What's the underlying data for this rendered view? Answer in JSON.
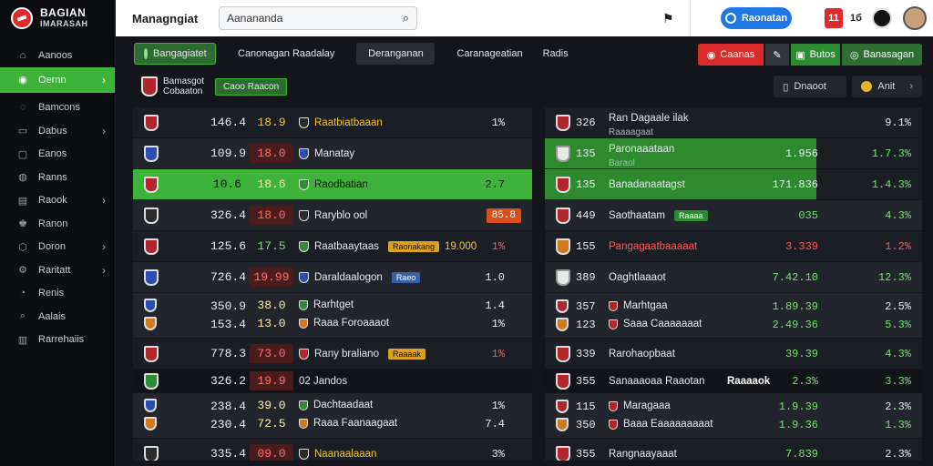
{
  "brand": {
    "line1": "BAGIAN",
    "line2": "IMARASAH"
  },
  "sidebar": {
    "items": [
      {
        "label": "Aanoos",
        "icon": "home-icon",
        "chevron": false,
        "active": false
      },
      {
        "label": "Oernn",
        "icon": "globe-icon",
        "chevron": true,
        "active": true
      },
      {
        "label": "Bamcons",
        "icon": "chat-icon",
        "chevron": false,
        "active": false
      },
      {
        "label": "Dabus",
        "icon": "folder-icon",
        "chevron": true,
        "active": false
      },
      {
        "label": "Eanos",
        "icon": "calendar-icon",
        "chevron": false,
        "active": false
      },
      {
        "label": "Ranns",
        "icon": "people-icon",
        "chevron": false,
        "active": false
      },
      {
        "label": "Raook",
        "icon": "book-icon",
        "chevron": true,
        "active": false
      },
      {
        "label": "Ranon",
        "icon": "trophy-icon",
        "chevron": false,
        "active": false
      },
      {
        "label": "Doron",
        "icon": "shield-icon",
        "chevron": true,
        "active": false
      },
      {
        "label": "Raritatt",
        "icon": "gear-icon",
        "chevron": true,
        "active": false
      },
      {
        "label": "Renis",
        "icon": "user-icon",
        "chevron": false,
        "active": false
      },
      {
        "label": "Aalais",
        "icon": "search-icon",
        "chevron": false,
        "active": false
      },
      {
        "label": "Rarrehaiis",
        "icon": "chart-icon",
        "chevron": false,
        "active": false
      }
    ]
  },
  "header": {
    "title": "Managngiat",
    "search_value": "Aanananda",
    "cta_label": "Raonatan",
    "badge": "11",
    "count": "1б"
  },
  "toolbar": {
    "tabs": [
      "Bangagiatet",
      "Canonagan Raadalay",
      "Deranganan",
      "Caranageatian",
      "Radis"
    ],
    "btn_red": "Caanas",
    "btn_green": "Butos",
    "btn_green2": "Banasagan"
  },
  "subrow": {
    "league_title": "Bamasgot",
    "league_sub": "Cobaaton",
    "league_badge": "Caoo  Raacon",
    "chip1": "Dnaoot",
    "chip2": "Anit"
  },
  "left_rows": [
    {
      "crest": "red",
      "val": "146.4",
      "odds": "18.9",
      "oc": "y",
      "team": "Raatbiatbaaan",
      "tc": "y",
      "icon": "dark",
      "end": "1%",
      "ec": "",
      "style": ""
    },
    {
      "crest": "blue",
      "val": "109.9",
      "odds": "18.0",
      "oc": "r",
      "team": "Manatay",
      "tc": "",
      "icon": "blue",
      "end": "",
      "ec": "",
      "style": "alt"
    },
    {
      "crest": "red",
      "val": "10.6",
      "odds": "18.6",
      "oc": "w",
      "team": "Raodbatian",
      "tc": "",
      "icon": "green",
      "end": "2.7",
      "ec": "",
      "style": "hl"
    },
    {
      "crest": "dark",
      "val": "326.4",
      "odds": "18.0",
      "oc": "r",
      "team": "Raryblo ool",
      "tc": "",
      "icon": "dark",
      "pill": "85.8",
      "style": "alt"
    },
    {
      "crest": "red",
      "val": "125.6",
      "odds": "17.5",
      "oc": "g",
      "team": "Raatbaaytaas",
      "tc": "",
      "icon": "green",
      "tag": "Raonakang",
      "tagc": "y",
      "extra": "19.000",
      "end": "1%",
      "ec": "r",
      "style": ""
    },
    {
      "crest": "blue",
      "val": "726.4",
      "odds": "19.99",
      "oc": "r",
      "team": "Daraldaalogon",
      "tc": "",
      "icon": "blue",
      "tag": "Raeo",
      "tagc": "b",
      "end": "1.0",
      "ec": "",
      "style": "alt"
    },
    {
      "crest": "red",
      "val": "778.3",
      "odds": "73.0",
      "oc": "r",
      "team": "Rany braliano",
      "tc": "",
      "icon": "red",
      "tag": "Raaaak",
      "tagc": "y",
      "end": "1%",
      "ec": "r",
      "style": ""
    },
    {
      "crest": "green",
      "val": "326.2",
      "odds": "19.9",
      "oc": "r",
      "team": "02 Jandos",
      "tc": "",
      "icon": "",
      "end": "",
      "ec": "",
      "style": "dark"
    },
    {
      "crest": "dark",
      "val": "335.4",
      "odds": "09.0",
      "oc": "r",
      "team": "Naanaalaaan",
      "tc": "y",
      "icon": "dark",
      "end": "3%",
      "ec": "",
      "style": ""
    }
  ],
  "left_doubles": [
    {
      "top": {
        "crest": "blue",
        "val": "350.9",
        "odds": "38.0",
        "team": "Rarhtget",
        "end": "1.4"
      },
      "bot": {
        "crest": "orange",
        "val": "153.4",
        "odds": "13.0",
        "team": "Raaa Foroaaaot",
        "end": "1%"
      }
    },
    {
      "top": {
        "crest": "blue",
        "val": "238.4",
        "odds": "39.0",
        "team": "Dachtaadaat",
        "end": "1%"
      },
      "bot": {
        "crest": "orange",
        "val": "230.4",
        "odds": "72.5",
        "team": "Raaa Faanaagaat",
        "end": "7.4"
      }
    }
  ],
  "right_rows": [
    {
      "val": "326",
      "team": "Ran Dagaale ilak",
      "sub": "Raaaagaat",
      "mid": "",
      "pct": "9.1%",
      "pc": "w"
    },
    {
      "val": "135",
      "team": "Paronaaataan",
      "sub": "Baraol",
      "mid": "1.956",
      "pct": "1.7.3%",
      "pc": "g"
    },
    {
      "val": "135",
      "team": "Banadanaatagst",
      "mid": "171.836",
      "pct": "1.4.3%",
      "pc": "g"
    },
    {
      "val": "449",
      "team": "Saothaatam",
      "tag": "Raaaa",
      "mid": "035",
      "pct": "4.3%",
      "pc": "g"
    },
    {
      "val": "155",
      "team": "Pangagaatbaaaaat",
      "mid": "3.339",
      "pct": "1.2%",
      "pc": "r"
    },
    {
      "val": "389",
      "team": "Oaghtlaaaot",
      "mid": "7.42.10",
      "pct": "12.3%",
      "pc": "g"
    },
    {
      "val": "339",
      "team": "Rarohaopbaat",
      "mid": "39.39",
      "pct": "4.3%",
      "pc": "g"
    },
    {
      "val": "355",
      "team": "Sanaaaoaa Raaotan",
      "mid": "2.3%",
      "pct": "3.3%",
      "pc": "g"
    },
    {
      "val": "355",
      "team": "Rangnaayaaat",
      "mid": "7.839",
      "pct": "2.3%",
      "pc": "w"
    }
  ],
  "right_doubles": [
    {
      "top": {
        "val": "357",
        "team": "Marhtgaa",
        "mid": "1.89.39",
        "pct": "2.5%"
      },
      "bot": {
        "val": "123",
        "team": "Saaa Caaaaaaat",
        "mid": "2.49.36",
        "pct": "5.3%"
      }
    },
    {
      "top": {
        "val": "115",
        "team": "Maragaaa",
        "mid": "1.9.39",
        "pct": "2.3%"
      },
      "bot": {
        "val": "350",
        "team": "Baaa Eaaaaaaaaat",
        "mid": "1.9.36",
        "pct": "1.3%"
      }
    }
  ],
  "right_extra": "Raaaaok"
}
